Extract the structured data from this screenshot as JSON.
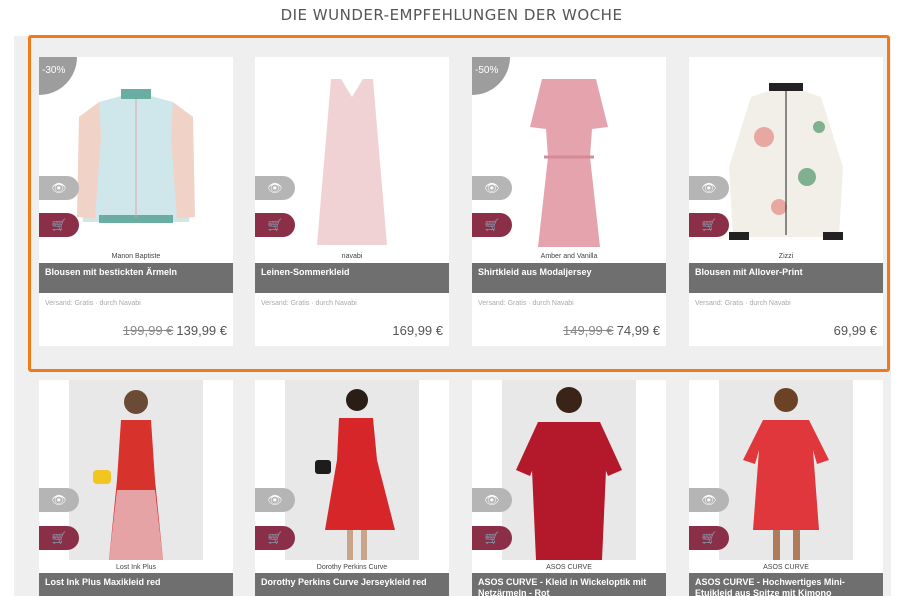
{
  "section": {
    "heading": "DIE WUNDER-EMPFEHLUNGEN DER WOCHE"
  },
  "colors": {
    "highlight_border": "#f07a1a",
    "cart_button": "#8b2f48",
    "eye_button": "#b5b5b5",
    "title_bar": "#6f6f6f",
    "discount_badge": "#9d9d9d"
  },
  "icons": {
    "eye": "eye-icon",
    "cart": "cart-icon"
  },
  "products": [
    {
      "brand": "Manon Baptiste",
      "title": "Blousen mit bestickten Ärmeln",
      "shipping": "Versand: Gratis · durch Navabi",
      "old_price": "199,99 €",
      "price": "139,99 €",
      "discount": "-30%"
    },
    {
      "brand": "navabi",
      "title": "Leinen-Sommerkleid",
      "shipping": "Versand: Gratis · durch Navabi",
      "old_price": "",
      "price": "169,99 €",
      "discount": ""
    },
    {
      "brand": "Amber and Vanilla",
      "title": "Shirtkleid aus Modaljersey",
      "shipping": "Versand: Gratis · durch Navabi",
      "old_price": "149,99 €",
      "price": "74,99 €",
      "discount": "-50%"
    },
    {
      "brand": "Zizzi",
      "title": "Blousen mit Allover-Print",
      "shipping": "Versand: Gratis · durch Navabi",
      "old_price": "",
      "price": "69,99 €",
      "discount": ""
    },
    {
      "brand": "Lost Ink Plus",
      "title": "Lost Ink Plus Maxikleid red"
    },
    {
      "brand": "Dorothy Perkins Curve",
      "title": "Dorothy Perkins Curve Jerseykleid red"
    },
    {
      "brand": "ASOS CURVE",
      "title": "ASOS CURVE - Kleid in Wickeloptik mit Netzärmeln - Rot"
    },
    {
      "brand": "ASOS CURVE",
      "title": "ASOS CURVE - Hochwertiges Mini-Etuikleid aus Spitze mit Kimono"
    }
  ]
}
